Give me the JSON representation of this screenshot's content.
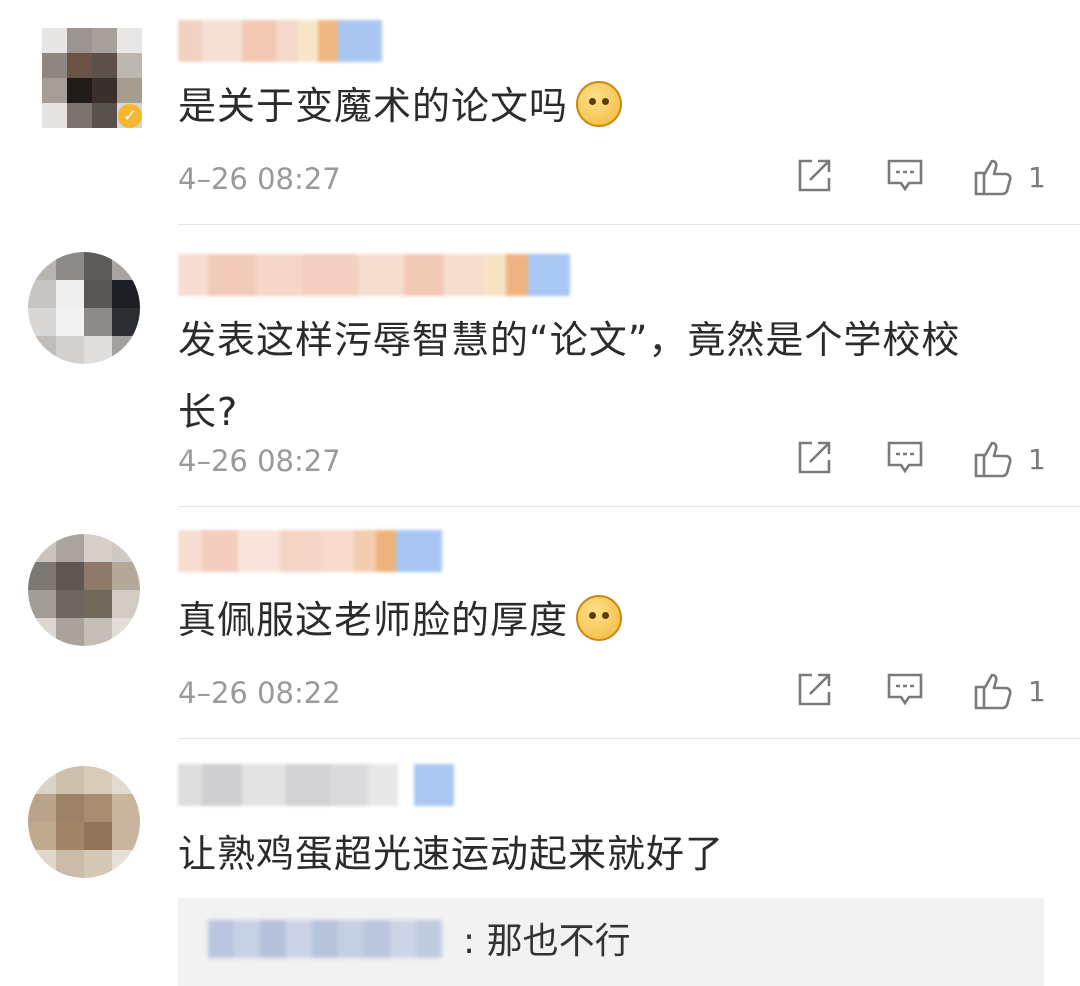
{
  "comments": [
    {
      "text": "是关于变魔术的论文吗",
      "emoji": "doge-emoji",
      "time": "4–26 08:27",
      "like_count": "1"
    },
    {
      "text": "发表这样污辱智慧的“论文”，竟然是个学校校长?",
      "emoji": "",
      "time": "4–26 08:27",
      "like_count": "1"
    },
    {
      "text": "真佩服这老师脸的厚度",
      "emoji": "shush-face-emoji",
      "time": "4–26 08:22",
      "like_count": "1"
    },
    {
      "text": "让熟鸡蛋超光速运动起来就好了",
      "emoji": "",
      "time": "",
      "like_count": ""
    }
  ],
  "reply": {
    "text": ": 那也不行"
  },
  "icons": {
    "share": "share-icon",
    "comment": "comment-icon",
    "like": "thumbs-up-icon",
    "verified": "verified-badge-icon"
  },
  "colors": {
    "time_text": "#9a9a9a",
    "icon": "#7a7a7a",
    "reply_bg": "#f2f2f2",
    "verified_badge": "#f5b731"
  }
}
